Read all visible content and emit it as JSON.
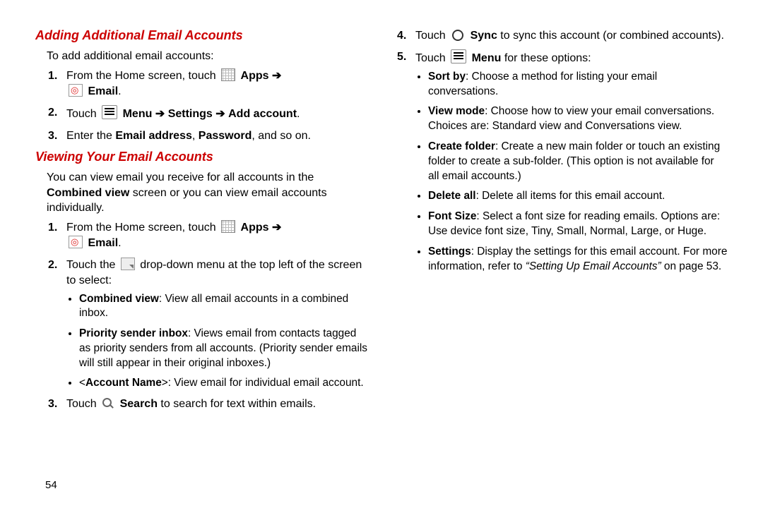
{
  "pageNumber": "54",
  "left": {
    "heading1": "Adding Additional Email Accounts",
    "intro": "To add additional email accounts:",
    "step1_a": "From the Home screen, touch ",
    "apps_label": "Apps",
    "arrow": "➔",
    "email_label": "Email",
    "step2_a": "Touch ",
    "menu_label": "Menu",
    "settings_label": "Settings",
    "addaccount_label": "Add account",
    "step3_a": "Enter the ",
    "step3_b": "Email address",
    "step3_c": ", ",
    "step3_d": "Password",
    "step3_e": ", and so on.",
    "heading2": "Viewing Your Email Accounts",
    "viewing_intro_a": "You can view email you receive for all accounts in the ",
    "viewing_intro_b": "Combined view",
    "viewing_intro_c": " screen or you can view email accounts individually.",
    "v_step1_a": "From the Home screen, touch ",
    "v_step2_a": "Touch the ",
    "v_step2_b": " drop-down menu at the top left of the screen to select:",
    "bul_cv_a": "Combined view",
    "bul_cv_b": ": View all email accounts in a combined inbox.",
    "bul_ps_a": "Priority sender inbox",
    "bul_ps_b": ": Views email from contacts tagged as priority senders from all accounts. (Priority sender emails will still appear in their original inboxes.)",
    "bul_an_a": "<",
    "bul_an_b": "Account Name",
    "bul_an_c": ">: View email for individual email account.",
    "v_step3_a": "Touch ",
    "search_label": "Search",
    "v_step3_b": " to search for text within emails."
  },
  "right": {
    "step4_a": "Touch ",
    "sync_label": "Sync",
    "step4_b": " to sync this account (or combined accounts).",
    "step5_a": "Touch ",
    "menu_label": "Menu",
    "step5_b": " for these options:",
    "bul_sort_a": "Sort by",
    "bul_sort_b": ": Choose a method for listing your email conversations.",
    "bul_vm_a": "View mode",
    "bul_vm_b": ": Choose how to view your email conversations. Choices are: Standard view and Conversations view.",
    "bul_cf_a": "Create folder",
    "bul_cf_b": ": Create a new main folder or touch an existing folder to create a sub-folder. (This option is not available for all email accounts.)",
    "bul_da_a": "Delete all",
    "bul_da_b": ": Delete all items for this email account.",
    "bul_fs_a": "Font Size",
    "bul_fs_b": ": Select a font size for reading emails. Options are: Use device font size, Tiny, Small, Normal, Large, or Huge.",
    "bul_set_a": "Settings",
    "bul_set_b": ": Display the settings for this email account. For more information, refer to ",
    "bul_set_c": "“Setting Up Email Accounts”",
    "bul_set_d": " on page 53."
  }
}
